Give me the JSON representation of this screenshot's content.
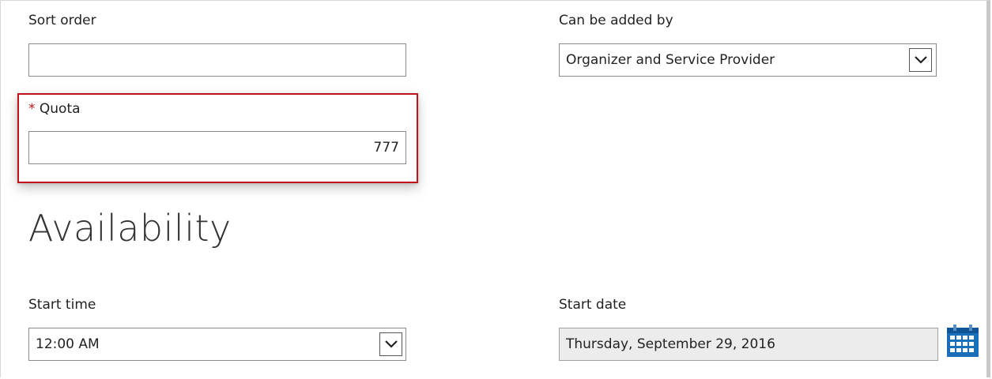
{
  "form": {
    "sort_order": {
      "label": "Sort order",
      "value": ""
    },
    "can_be_added_by": {
      "label": "Can be added by",
      "selected": "Organizer and Service Provider"
    },
    "quota": {
      "required_mark": "*",
      "label": "Quota",
      "value": "777"
    }
  },
  "availability": {
    "title": "Availability",
    "start_time": {
      "label": "Start time",
      "selected": "12:00 AM"
    },
    "start_date": {
      "label": "Start date",
      "value": "Thursday, September 29, 2016"
    }
  },
  "colors": {
    "highlight_border": "#c0121b",
    "required_star": "#c0121b",
    "calendar_icon": "#1a6fb8"
  },
  "icons": [
    "chevron-down-icon",
    "calendar-icon"
  ]
}
